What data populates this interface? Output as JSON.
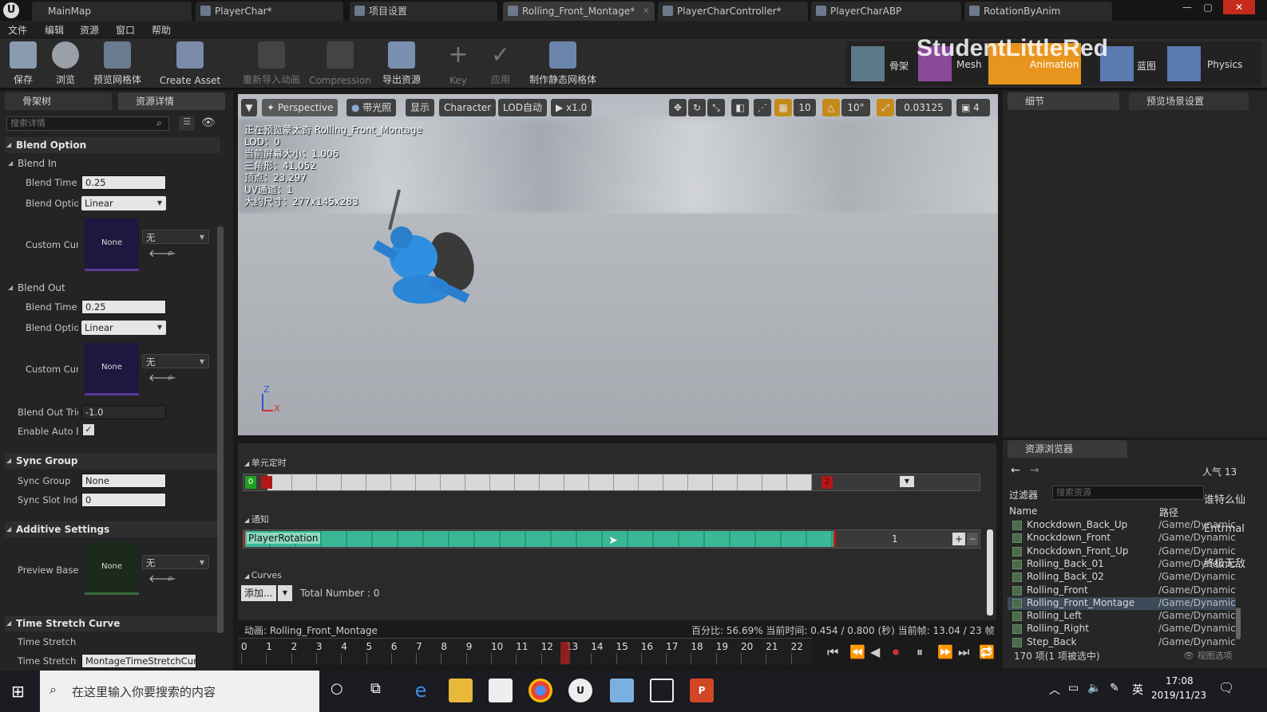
{
  "window": {
    "tabs": [
      "MainMap",
      "PlayerChar*",
      "项目设置",
      "Rolling_Front_Montage*",
      "PlayerCharController*",
      "PlayerCharABP",
      "RotationByAnim"
    ]
  },
  "menu": [
    "文件",
    "编辑",
    "资源",
    "窗口",
    "帮助"
  ],
  "toolbar": {
    "save": "保存",
    "browse": "浏览",
    "preview_mesh": "预览网格体",
    "create_asset": "Create Asset",
    "reimport": "重新导入动画",
    "compression": "Compression",
    "export": "导出资源",
    "key": "Key",
    "apply": "应用",
    "make_static": "制作静态网格体",
    "modes": [
      "骨架",
      "Mesh",
      "Animation",
      "蓝图",
      "Physics"
    ]
  },
  "watermark": "StudentLittleRed",
  "left_panel": {
    "tab_skeleton": "骨架树",
    "tab_details": "资源详情",
    "search_placeholder": "搜索详情",
    "blend_option": "Blend Option",
    "blend_in": "Blend In",
    "blend_time_label": "Blend Time",
    "blend_in_time": "0.25",
    "blend_option_label": "Blend Optior",
    "blend_in_option": "Linear",
    "custom_curve_label": "Custom Cur\\",
    "none": "None",
    "wu": "无",
    "blend_out": "Blend Out",
    "blend_out_time": "0.25",
    "blend_out_option": "Linear",
    "blend_out_trigger_label": "Blend Out Trig",
    "blend_out_trigger": "-1.0",
    "enable_auto_label": "Enable Auto B",
    "sync_group_h": "Sync Group",
    "sync_group_label": "Sync Group",
    "sync_group_value": "None",
    "sync_slot_label": "Sync Slot Inde",
    "sync_slot_value": "0",
    "additive_h": "Additive Settings",
    "preview_base_label": "Preview Base",
    "time_stretch_h": "Time Stretch Curve",
    "time_stretch_label": "Time Stretch (",
    "time_stretch_label2": "Time Stretch (",
    "time_stretch_value": "MontageTimeStretchCurv"
  },
  "viewport": {
    "perspective": "Perspective",
    "lit": "带光照",
    "show": "显示",
    "character": "Character",
    "lod": "LOD自动",
    "speed": "x1.0",
    "grid": "10",
    "angle": "10°",
    "scale": "0.03125",
    "camera_speed": "4",
    "info": [
      "正在预览蒙太奇 Rolling_Front_Montage",
      "LOD：0",
      "当前屏幕大小：1.006",
      "三角形：41,052",
      "顶点：23,297",
      "UV通道：1",
      "大约尺寸：277x145x283"
    ],
    "axis_z": "Z",
    "axis_x": "X"
  },
  "montage": {
    "sections_label": "单元定时",
    "start_marker": "0",
    "end_marker": "2",
    "notify_label": "通知",
    "notify_name": "PlayerRotation",
    "notify_track": "1",
    "curves_label": "Curves",
    "add": "添加...",
    "total": "Total Number : 0",
    "status_anim": "动画:  Rolling_Front_Montage",
    "status_info": "百分比:  56.69%  当前时间:  0.454 / 0.800 (秒) 当前帧:  13.04 / 23 帧",
    "ticks": [
      "0",
      "1",
      "2",
      "3",
      "4",
      "5",
      "6",
      "7",
      "8",
      "9",
      "10",
      "11",
      "12",
      "13",
      "14",
      "15",
      "16",
      "17",
      "18",
      "19",
      "20",
      "21",
      "22"
    ]
  },
  "right_panel": {
    "details": "细节",
    "preview_scene": "预览场景设置",
    "browser": "资源浏览器",
    "popularity": "人气 13",
    "filter": "过滤器",
    "search_placeholder": "搜索资源",
    "col_name": "Name",
    "col_path": "路径",
    "assets": [
      {
        "name": "Knockdown_Back_Up",
        "path": "/Game/Dynamic"
      },
      {
        "name": "Knockdown_Front",
        "path": "/Game/Dynamic"
      },
      {
        "name": "Knockdown_Front_Up",
        "path": "/Game/Dynamic"
      },
      {
        "name": "Rolling_Back_01",
        "path": "/Game/Dynamic"
      },
      {
        "name": "Rolling_Back_02",
        "path": "/Game/Dynamic"
      },
      {
        "name": "Rolling_Front",
        "path": "/Game/Dynamic"
      },
      {
        "name": "Rolling_Front_Montage",
        "path": "/Game/Dynamic"
      },
      {
        "name": "Rolling_Left",
        "path": "/Game/Dynamic"
      },
      {
        "name": "Rolling_Right",
        "path": "/Game/Dynamic"
      },
      {
        "name": "Step_Back",
        "path": "/Game/Dynamic"
      }
    ],
    "count": "170 项(1 项被选中)",
    "view_options": "视图选项",
    "danmaku": [
      "谁特么仙",
      "Entrmal",
      "终极无敌"
    ]
  },
  "taskbar": {
    "search": "在这里输入你要搜索的内容",
    "time": "17:08",
    "date": "2019/11/23",
    "ime": "英"
  }
}
